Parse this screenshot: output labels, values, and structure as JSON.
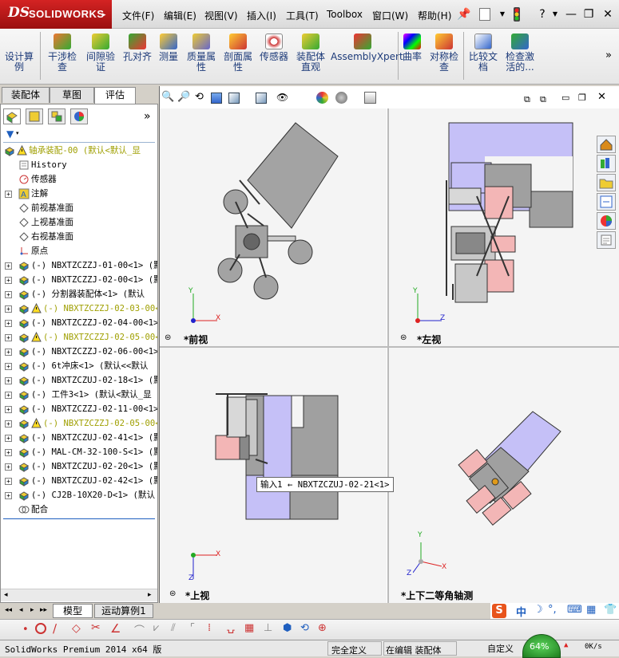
{
  "app": {
    "brand_ds": "DS",
    "brand_name": "SOLIDWORKS"
  },
  "menu": [
    "文件(F)",
    "编辑(E)",
    "视图(V)",
    "插入(I)",
    "工具(T)",
    "Toolbox",
    "窗口(W)",
    "帮助(H)"
  ],
  "command_manager": [
    {
      "label": "设计算\n例",
      "icon": "design-study-icon"
    },
    {
      "label": "干涉检\n查",
      "icon": "interference-check-icon"
    },
    {
      "label": "间隙验\n证",
      "icon": "clearance-verification-icon"
    },
    {
      "label": "孔对齐",
      "icon": "hole-alignment-icon"
    },
    {
      "label": "测量",
      "icon": "measure-icon"
    },
    {
      "label": "质量属\n性",
      "icon": "mass-properties-icon"
    },
    {
      "label": "剖面属\n性",
      "icon": "section-properties-icon"
    },
    {
      "label": "传感器",
      "icon": "sensor-icon"
    },
    {
      "label": "装配体\n直观",
      "icon": "assembly-visualization-icon"
    },
    {
      "label": "AssemblyXpert",
      "icon": "assemblyxpert-icon"
    },
    {
      "label": "曲率",
      "icon": "curvature-icon"
    },
    {
      "label": "对称检\n查",
      "icon": "symmetry-check-icon"
    },
    {
      "label": "比较文\n档",
      "icon": "compare-documents-icon"
    },
    {
      "label": "检查激\n活的...",
      "icon": "check-active-icon"
    }
  ],
  "tabs": [
    "装配体",
    "草图",
    "评估"
  ],
  "tree": [
    {
      "label": "轴承装配-00 (默认<默认_显",
      "type": "root",
      "warn": true,
      "yellow": true
    },
    {
      "label": "History",
      "type": "history"
    },
    {
      "label": "传感器",
      "type": "sensor"
    },
    {
      "label": "注解",
      "type": "annotation",
      "expand": true
    },
    {
      "label": "前视基准面",
      "type": "plane"
    },
    {
      "label": "上视基准面",
      "type": "plane"
    },
    {
      "label": "右视基准面",
      "type": "plane"
    },
    {
      "label": "原点",
      "type": "origin"
    },
    {
      "label": "(-) NBXTZCZZJ-01-00<1> (默",
      "type": "part",
      "expand": true
    },
    {
      "label": "(-) NBXTZCZZJ-02-00<1> (默",
      "type": "part",
      "expand": true
    },
    {
      "label": "(-) 分割器装配体<1> (默认",
      "type": "part",
      "expand": true
    },
    {
      "label": "(-) NBXTZCZZJ-02-03-00<",
      "type": "part",
      "expand": true,
      "warn": true,
      "yellow": true
    },
    {
      "label": "(-) NBXTZCZZJ-02-04-00<1>",
      "type": "part",
      "expand": true
    },
    {
      "label": "(-) NBXTZCZZJ-02-05-00<",
      "type": "part",
      "expand": true,
      "warn": true,
      "yellow": true
    },
    {
      "label": "(-) NBXTZCZZJ-02-06-00<1>",
      "type": "part",
      "expand": true
    },
    {
      "label": "(-) 6t冲床<1> (默认<<默认",
      "type": "part",
      "expand": true
    },
    {
      "label": "(-) NBXTZCZUJ-02-18<1> (默",
      "type": "part",
      "expand": true
    },
    {
      "label": "(-) 工件3<1> (默认<默认_显",
      "type": "part",
      "expand": true
    },
    {
      "label": "(-) NBXTZCZZJ-02-11-00<1>",
      "type": "part",
      "expand": true
    },
    {
      "label": "(-) NBXTZCZZJ-02-05-00<",
      "type": "part",
      "expand": true,
      "warn": true,
      "yellow": true
    },
    {
      "label": "(-) NBXTZCZUJ-02-41<1> (默",
      "type": "part",
      "expand": true
    },
    {
      "label": "(-) MAL-CM-32-100-S<1> (默",
      "type": "part",
      "expand": true
    },
    {
      "label": "(-) NBXTZCZUJ-02-20<1> (默",
      "type": "part",
      "expand": true
    },
    {
      "label": "(-) NBXTZCZUJ-02-42<1> (默",
      "type": "part",
      "expand": true
    },
    {
      "label": "(-) CJ2B-10X20-D<1> (默认",
      "type": "part",
      "expand": true
    },
    {
      "label": "配合",
      "type": "mates"
    }
  ],
  "views": {
    "front": "*前视",
    "left": "*左视",
    "top": "*上视",
    "iso": "*上下二等角轴测"
  },
  "tooltip": "输入1 ← NBXTZCZUJ-02-21<1>",
  "axes": {
    "x": "X",
    "y": "Y",
    "z": "Z"
  },
  "bottom_tabs": [
    "模型",
    "运动算例1"
  ],
  "status": {
    "product": "SolidWorks Premium 2014 x64 版",
    "definition": "完全定义",
    "editing": "在编辑 装配体",
    "custom": "自定义",
    "cpu": "64%",
    "rate": "0K/s"
  },
  "colors": {
    "brand": "#c0161b",
    "part_purple": "#c5c0f7",
    "part_grey": "#a0a0a0",
    "pink": "#f3b6b6"
  }
}
